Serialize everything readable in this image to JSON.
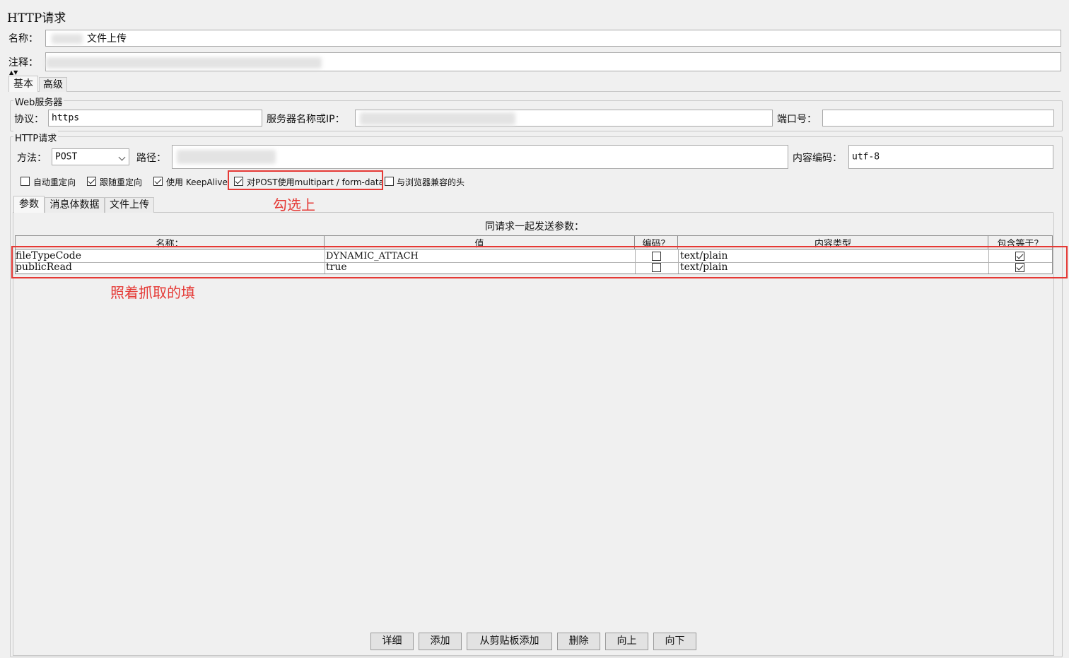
{
  "panel_title": "HTTP请求",
  "name_label": "名称：",
  "name_value": "文件上传",
  "comment_label": "注释：",
  "tabs": [
    "基本",
    "高级"
  ],
  "web_server": {
    "group_title": "Web服务器",
    "protocol_label": "协议：",
    "protocol_value": "https",
    "server_label": "服务器名称或IP：",
    "port_label": "端口号："
  },
  "http_request": {
    "group_title": "HTTP请求",
    "method_label": "方法：",
    "method_value": "POST",
    "path_label": "路径：",
    "encoding_label": "内容编码：",
    "encoding_value": "utf-8"
  },
  "checkboxes": [
    {
      "label": "自动重定向",
      "checked": false
    },
    {
      "label": "跟随重定向",
      "checked": true
    },
    {
      "label": "使用 KeepAlive",
      "checked": true
    },
    {
      "label": "对POST使用multipart / form-data",
      "checked": true
    },
    {
      "label": "与浏览器兼容的头",
      "checked": false
    }
  ],
  "sub_tabs": [
    "参数",
    "消息体数据",
    "文件上传"
  ],
  "params_caption": "同请求一起发送参数：",
  "columns": [
    "名称：",
    "值",
    "编码？",
    "内容类型",
    "包含等于？"
  ],
  "rows": [
    {
      "name": "fileTypeCode",
      "value": "DYNAMIC_ATTACH",
      "encode": false,
      "content_type": "text/plain",
      "include_equals": true
    },
    {
      "name": "publicRead",
      "value": "true",
      "encode": false,
      "content_type": "text/plain",
      "include_equals": true
    }
  ],
  "buttons": [
    "详细",
    "添加",
    "从剪贴板添加",
    "删除",
    "向上",
    "向下"
  ],
  "annotations": {
    "checkbox_note": "勾选上",
    "table_note": "照着抓取的填",
    "color": "#e53935"
  }
}
